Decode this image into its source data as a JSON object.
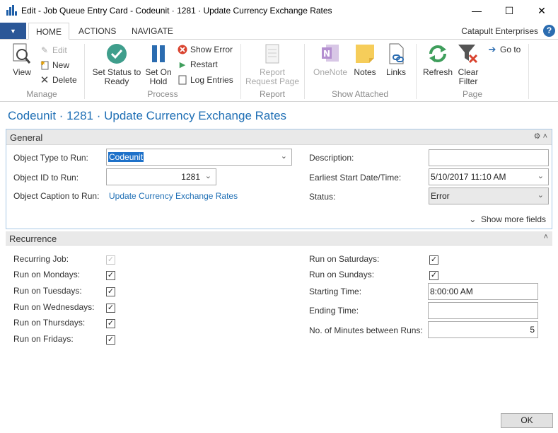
{
  "window": {
    "title": "Edit - Job Queue Entry Card - Codeunit · 1281 · Update Currency Exchange Rates",
    "minimize": "—",
    "maximize": "☐",
    "close": "✕"
  },
  "ribbon_tabs": {
    "app_menu": "▼",
    "home": "HOME",
    "actions": "ACTIONS",
    "navigate": "NAVIGATE",
    "company": "Catapult Enterprises",
    "help": "?"
  },
  "ribbon": {
    "manage": {
      "label": "Manage",
      "view": "View",
      "edit": "Edit",
      "new": "New",
      "delete": "Delete"
    },
    "process": {
      "label": "Process",
      "set_status_ready_1": "Set Status to",
      "set_status_ready_2": "Ready",
      "set_on_hold_1": "Set On",
      "set_on_hold_2": "Hold",
      "show_error": "Show Error",
      "restart": "Restart",
      "log_entries": "Log Entries"
    },
    "report": {
      "label": "Report",
      "request_page_1": "Report",
      "request_page_2": "Request Page"
    },
    "show_attached": {
      "label": "Show Attached",
      "onenote": "OneNote",
      "notes": "Notes",
      "links": "Links"
    },
    "page": {
      "label": "Page",
      "refresh": "Refresh",
      "clear_filter_1": "Clear",
      "clear_filter_2": "Filter",
      "goto": "Go to"
    }
  },
  "page_title": "Codeunit · 1281 · Update Currency Exchange Rates",
  "general": {
    "header": "General",
    "object_type_label": "Object Type to Run:",
    "object_type_value": "Codeunit",
    "object_id_label": "Object ID to Run:",
    "object_id_value": "1281",
    "object_caption_label": "Object Caption to Run:",
    "object_caption_value": "Update Currency Exchange Rates",
    "description_label": "Description:",
    "description_value": "",
    "earliest_start_label": "Earliest Start Date/Time:",
    "earliest_start_value": "5/10/2017 11:10 AM",
    "status_label": "Status:",
    "status_value": "Error",
    "show_more": "Show more fields"
  },
  "recurrence": {
    "header": "Recurrence",
    "recurring_job": "Recurring Job:",
    "mondays": "Run on Mondays:",
    "tuesdays": "Run on Tuesdays:",
    "wednesdays": "Run on Wednesdays:",
    "thursdays": "Run on Thursdays:",
    "fridays": "Run on Fridays:",
    "saturdays": "Run on Saturdays:",
    "sundays": "Run on Sundays:",
    "starting_time_label": "Starting Time:",
    "starting_time_value": "8:00:00 AM",
    "ending_time_label": "Ending Time:",
    "ending_time_value": "",
    "minutes_label": "No. of Minutes between Runs:",
    "minutes_value": "5",
    "check": "✓"
  },
  "footer": {
    "ok": "OK"
  },
  "colors": {
    "accent": "#1f6fb5",
    "app_menu": "#2b5797",
    "fasttab_border": "#a9c8e6",
    "selection": "#1e71c9"
  }
}
